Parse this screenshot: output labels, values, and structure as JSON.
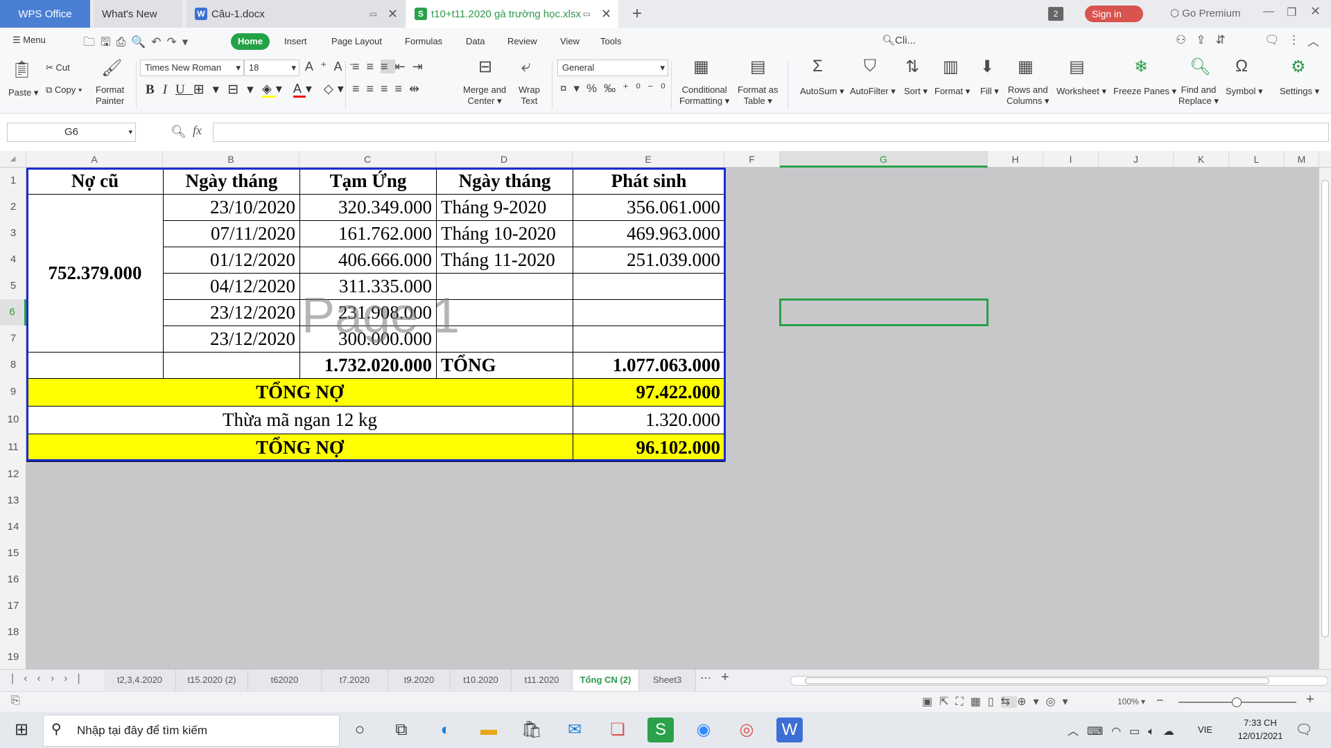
{
  "titlebar": {
    "tabs": [
      {
        "label": "WPS Office"
      },
      {
        "label": "What's New"
      },
      {
        "label": "Câu-1.docx"
      },
      {
        "label": "t10+t11.2020 gà trường học.xlsx"
      }
    ],
    "badge": "2",
    "sign_in": "Sign in",
    "premium": "Go Premium"
  },
  "menubar": {
    "menu": "Menu",
    "tabs": [
      "Home",
      "Insert",
      "Page Layout",
      "Formulas",
      "Data",
      "Review",
      "View",
      "Tools"
    ],
    "search": "Cli..."
  },
  "ribbon": {
    "paste": "Paste",
    "cut": "Cut",
    "copy": "Copy",
    "format_painter_1": "Format",
    "format_painter_2": "Painter",
    "font_name": "Times New Roman",
    "font_size": "18",
    "merge_1": "Merge and",
    "merge_2": "Center",
    "wrap_1": "Wrap",
    "wrap_2": "Text",
    "number_format": "General",
    "cond_1": "Conditional",
    "cond_2": "Formatting",
    "fat_1": "Format as",
    "fat_2": "Table",
    "autosum": "AutoSum",
    "autofilter": "AutoFilter",
    "sort": "Sort",
    "format": "Format",
    "fill": "Fill",
    "rows_1": "Rows and",
    "rows_2": "Columns",
    "worksheet": "Worksheet",
    "freeze": "Freeze Panes",
    "find_1": "Find and",
    "find_2": "Replace",
    "symbol": "Symbol",
    "settings": "Settings"
  },
  "formula_bar": {
    "name_box": "G6",
    "fx": "fx",
    "value": ""
  },
  "columns": [
    "A",
    "B",
    "C",
    "D",
    "E",
    "F",
    "G",
    "H",
    "I",
    "J",
    "K",
    "L",
    "M"
  ],
  "rows": [
    "1",
    "2",
    "3",
    "4",
    "5",
    "6",
    "7",
    "8",
    "9",
    "10",
    "11",
    "12",
    "13",
    "14",
    "15",
    "16",
    "17",
    "18",
    "19"
  ],
  "sheet": {
    "header": [
      "Nợ cũ",
      "Ngày tháng",
      "Tạm Ứng",
      "Ngày tháng",
      "Phát sinh"
    ],
    "no_cu": "752.379.000",
    "r2": [
      "23/10/2020",
      "320.349.000",
      "Tháng 9-2020",
      "356.061.000"
    ],
    "r3": [
      "07/11/2020",
      "161.762.000",
      "Tháng 10-2020",
      "469.963.000"
    ],
    "r4": [
      "01/12/2020",
      "406.666.000",
      "Tháng 11-2020",
      "251.039.000"
    ],
    "r5": [
      "04/12/2020",
      "311.335.000",
      "",
      ""
    ],
    "r6": [
      "23/12/2020",
      "231.908.000",
      "",
      ""
    ],
    "r7": [
      "23/12/2020",
      "300.000.000",
      "",
      ""
    ],
    "r8": [
      "",
      "",
      "1.732.020.000",
      "TỔNG",
      "1.077.063.000"
    ],
    "r9": [
      "TỔNG NỢ",
      "97.422.000"
    ],
    "r10": [
      "Thừa mã ngan 12 kg",
      "1.320.000"
    ],
    "r11": [
      "TỔNG NỢ",
      "96.102.000"
    ],
    "watermark": "Page 1"
  },
  "sheet_tabs": [
    "t2,3,4.2020",
    "t15.2020  (2)",
    "t62020",
    "t7.2020",
    "t9.2020",
    "t10.2020",
    "t11.2020",
    "Tổng CN (2)",
    "Sheet3"
  ],
  "status": {
    "zoom": "100%"
  },
  "taskbar": {
    "search_placeholder": "Nhập tại đây để tìm kiếm",
    "lang": "VIE",
    "time": "7:33 CH",
    "date": "12/01/2021"
  }
}
